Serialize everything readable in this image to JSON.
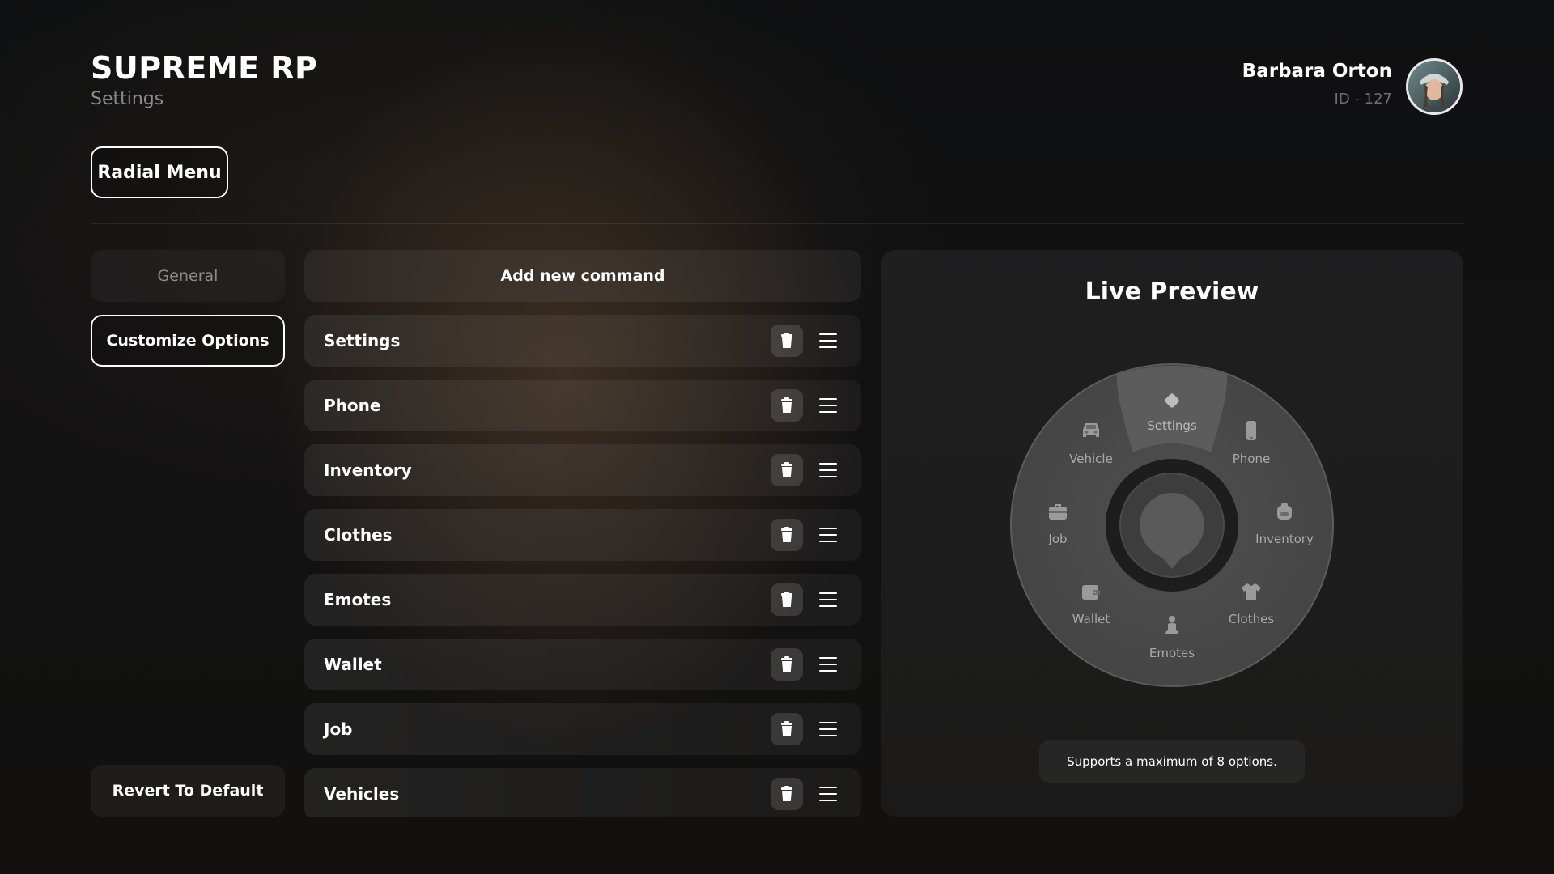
{
  "header": {
    "brand": "SUPREME RP",
    "subtitle": "Settings",
    "user_name": "Barbara Orton",
    "user_id": "ID - 127"
  },
  "tabs": [
    {
      "label": "Radial Menu",
      "active": true
    }
  ],
  "sidebar": {
    "items": [
      {
        "label": "General",
        "active": false
      },
      {
        "label": "Customize Options",
        "active": true
      }
    ],
    "revert_label": "Revert To Default"
  },
  "commands": {
    "add_label": "Add new command",
    "items": [
      {
        "label": "Settings"
      },
      {
        "label": "Phone"
      },
      {
        "label": "Inventory"
      },
      {
        "label": "Clothes"
      },
      {
        "label": "Emotes"
      },
      {
        "label": "Wallet"
      },
      {
        "label": "Job"
      },
      {
        "label": "Vehicles"
      }
    ]
  },
  "preview": {
    "title": "Live Preview",
    "note": "Supports a maximum of 8 options.",
    "options": [
      {
        "label": "Settings",
        "icon": "gear-icon",
        "selected": true
      },
      {
        "label": "Phone",
        "icon": "phone-icon"
      },
      {
        "label": "Inventory",
        "icon": "backpack-icon"
      },
      {
        "label": "Clothes",
        "icon": "shirt-icon"
      },
      {
        "label": "Emotes",
        "icon": "person-icon"
      },
      {
        "label": "Wallet",
        "icon": "wallet-icon"
      },
      {
        "label": "Job",
        "icon": "briefcase-icon"
      },
      {
        "label": "Vehicle",
        "icon": "car-icon"
      }
    ]
  },
  "colors": {
    "text": "#ffffff",
    "muted": "#8c8c8c",
    "radial_fill": "#4a4a4a",
    "radial_selected": "#5a5a5a"
  }
}
